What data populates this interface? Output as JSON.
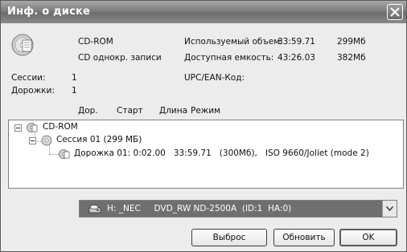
{
  "window": {
    "title": "Инф. о диске",
    "close_symbol": "✕"
  },
  "disc": {
    "type": "CD-ROM",
    "subtype": "CD однокр. записи",
    "used_label": "Используемый объем:",
    "used_time": "33:59.71",
    "used_size": "299Мб",
    "free_label": "Доступная емкость:",
    "free_time": "43:26.03",
    "free_size": "382Мб",
    "sessions_label": "Сессии:",
    "sessions_value": "1",
    "tracks_label": "Дорожки:",
    "tracks_value": "1",
    "upc_label": "UPC/EAN-Код:"
  },
  "columns": [
    "Дор.",
    "Старт",
    "Длина",
    "Режим"
  ],
  "tree": {
    "root": "CD-ROM",
    "session": "Сессия 01 (299 МБ)",
    "track": "Дорожка 01: 0:02.00   33:59.71   (300Мб),   ISO 9660/Joliet (mode 2)"
  },
  "drive": {
    "selected": "H: _NEC     DVD_RW ND-2500A  (ID:1  HA:0)"
  },
  "buttons": {
    "eject": "Выброс",
    "refresh": "Обновить",
    "ok": "OK"
  }
}
